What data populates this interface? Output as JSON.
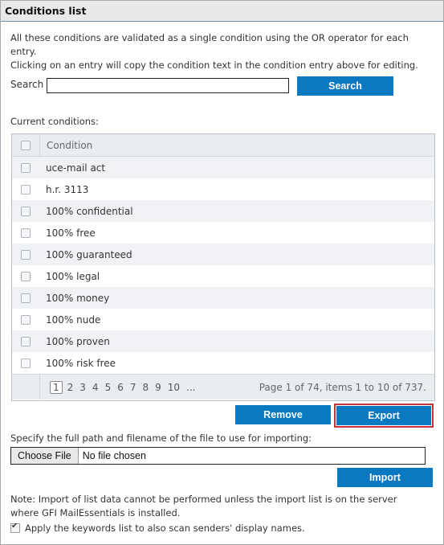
{
  "panel": {
    "title": "Conditions list"
  },
  "description": [
    "All these conditions are validated as a single condition using the OR operator for each entry.",
    "Clicking on an entry will copy the condition text in the condition entry above for editing."
  ],
  "search": {
    "label": "Search",
    "value": "",
    "button": "Search"
  },
  "current_conditions_label": "Current conditions:",
  "grid": {
    "column": "Condition",
    "rows": [
      "uce-mail act",
      "h.r. 3113",
      "100% confidential",
      "100% free",
      "100% guaranteed",
      "100% legal",
      "100% money",
      "100% nude",
      "100% proven",
      "100% risk free"
    ],
    "pager": {
      "current": "1",
      "pages": [
        "2",
        "3",
        "4",
        "5",
        "6",
        "7",
        "8",
        "9",
        "10",
        "..."
      ],
      "info": "Page 1 of 74, items 1 to 10 of 737."
    }
  },
  "actions": {
    "remove": "Remove",
    "export": "Export"
  },
  "import": {
    "label": "Specify the full path and filename of the file to use for importing:",
    "choose": "Choose File",
    "no_file": "No file chosen",
    "button": "Import",
    "note": "Note: Import of list data cannot be performed unless the import list is on the server where GFI MailEssentials is installed."
  },
  "apply_option": {
    "label": "Apply the keywords list to also scan senders' display names.",
    "checked": true
  },
  "colors": {
    "accent": "#0b78c2",
    "highlight_border": "#c8323c"
  }
}
